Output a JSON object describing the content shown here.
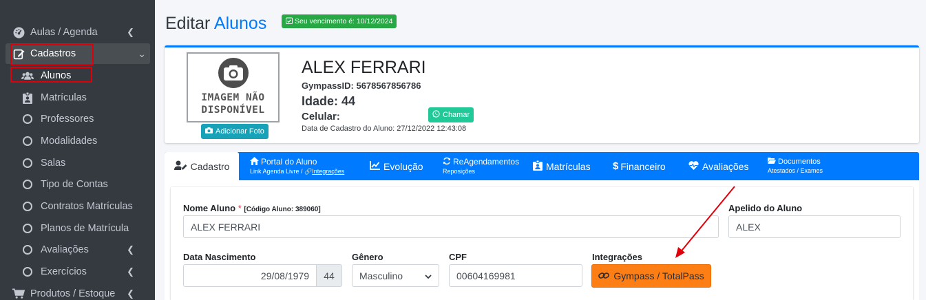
{
  "sidebar": {
    "items": [
      {
        "label": "Aulas / Agenda",
        "icon": "dashboard-icon"
      },
      {
        "label": "Cadastros",
        "icon": "edit-icon"
      },
      {
        "label": "Alunos",
        "icon": "users-icon"
      },
      {
        "label": "Matrículas",
        "icon": "id-badge-icon"
      },
      {
        "label": "Professores",
        "icon": "circle-icon"
      },
      {
        "label": "Modalidades",
        "icon": "circle-icon"
      },
      {
        "label": "Salas",
        "icon": "circle-icon"
      },
      {
        "label": "Tipo de Contas",
        "icon": "circle-icon"
      },
      {
        "label": "Contratos Matrículas",
        "icon": "circle-icon"
      },
      {
        "label": "Planos de Matrícula",
        "icon": "circle-icon"
      },
      {
        "label": "Avaliações",
        "icon": "circle-icon"
      },
      {
        "label": "Exercícios",
        "icon": "circle-icon"
      },
      {
        "label": "Produtos / Estoque",
        "icon": "cart-icon"
      }
    ]
  },
  "header": {
    "title_prefix": "Editar",
    "title_accent": "Alunos",
    "badge": "Seu vencimento é: 10/12/2024"
  },
  "profile": {
    "no_image_line1": "IMAGEM NÃO",
    "no_image_line2": "DISPONÍVEL",
    "add_photo": "Adicionar Foto",
    "name": "ALEX FERRARI",
    "gympass_id": "GympassID: 5678567856786",
    "age": "Idade: 44",
    "phone_label": "Celular:",
    "call_button": "Chamar",
    "register_date": "Data de Cadastro do Aluno: 27/12/2022 12:43:08"
  },
  "tabs": [
    {
      "label": "Cadastro",
      "active": true
    },
    {
      "label": "Portal do Aluno",
      "sub": "Link Agenda Livre / ",
      "sub_link": "Integrações"
    },
    {
      "label": "Evolução"
    },
    {
      "label": "ReAgendamentos",
      "sub": "Reposições"
    },
    {
      "label": "Matrículas"
    },
    {
      "label": "Financeiro"
    },
    {
      "label": "Avaliações"
    },
    {
      "label": "Documentos",
      "sub": "Atestados / Exames"
    }
  ],
  "form": {
    "nome_label": "Nome Aluno",
    "required_mark": "*",
    "codigo": "[Código Aluno: 389060]",
    "nome_value": "ALEX FERRARI",
    "apelido_label": "Apelido do Aluno",
    "apelido_value": "ALEX",
    "nascimento_label": "Data Nascimento",
    "nascimento_value": "29/08/1979",
    "idade_value": "44",
    "genero_label": "Gênero",
    "genero_value": "Masculino",
    "cpf_label": "CPF",
    "cpf_value": "00604169981",
    "integracoes_label": "Integrações",
    "integracoes_button": "Gympass / TotalPass"
  },
  "colors": {
    "sidebar_bg": "#343a40",
    "primary": "#007bff",
    "success": "#28a745",
    "info": "#17a2b8",
    "teal": "#20c997",
    "orange": "#fd7e14",
    "annotation_red": "#e0000a"
  }
}
